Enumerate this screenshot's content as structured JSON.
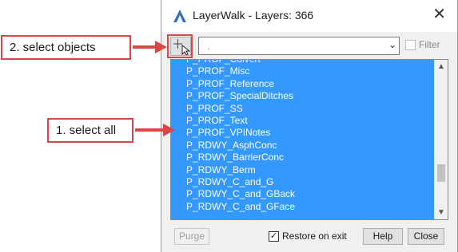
{
  "dialog": {
    "title": "LayerWalk - Layers: 366",
    "combo_value": ".",
    "filter_label": "Filter",
    "layers": [
      "P_PROF_Culvert",
      "P_PROF_Misc",
      "P_PROF_Reference",
      "P_PROF_SpecialDitches",
      "P_PROF_SS",
      "P_PROF_Text",
      "P_PROF_VPINotes",
      "P_RDWY_AsphConc",
      "P_RDWY_BarrierConc",
      "P_RDWY_Berm",
      "P_RDWY_C_and_G",
      "P_RDWY_C_and_GBack",
      "P_RDWY_C_and_GFace"
    ],
    "purge_label": "Purge",
    "restore_label": "Restore on exit",
    "restore_checked": true,
    "help_label": "Help",
    "close_label": "Close",
    "selection_color": "#3399ff"
  },
  "annotations": {
    "step2": "2. select objects",
    "step1": "1. select all",
    "accent_color": "#d94747"
  }
}
